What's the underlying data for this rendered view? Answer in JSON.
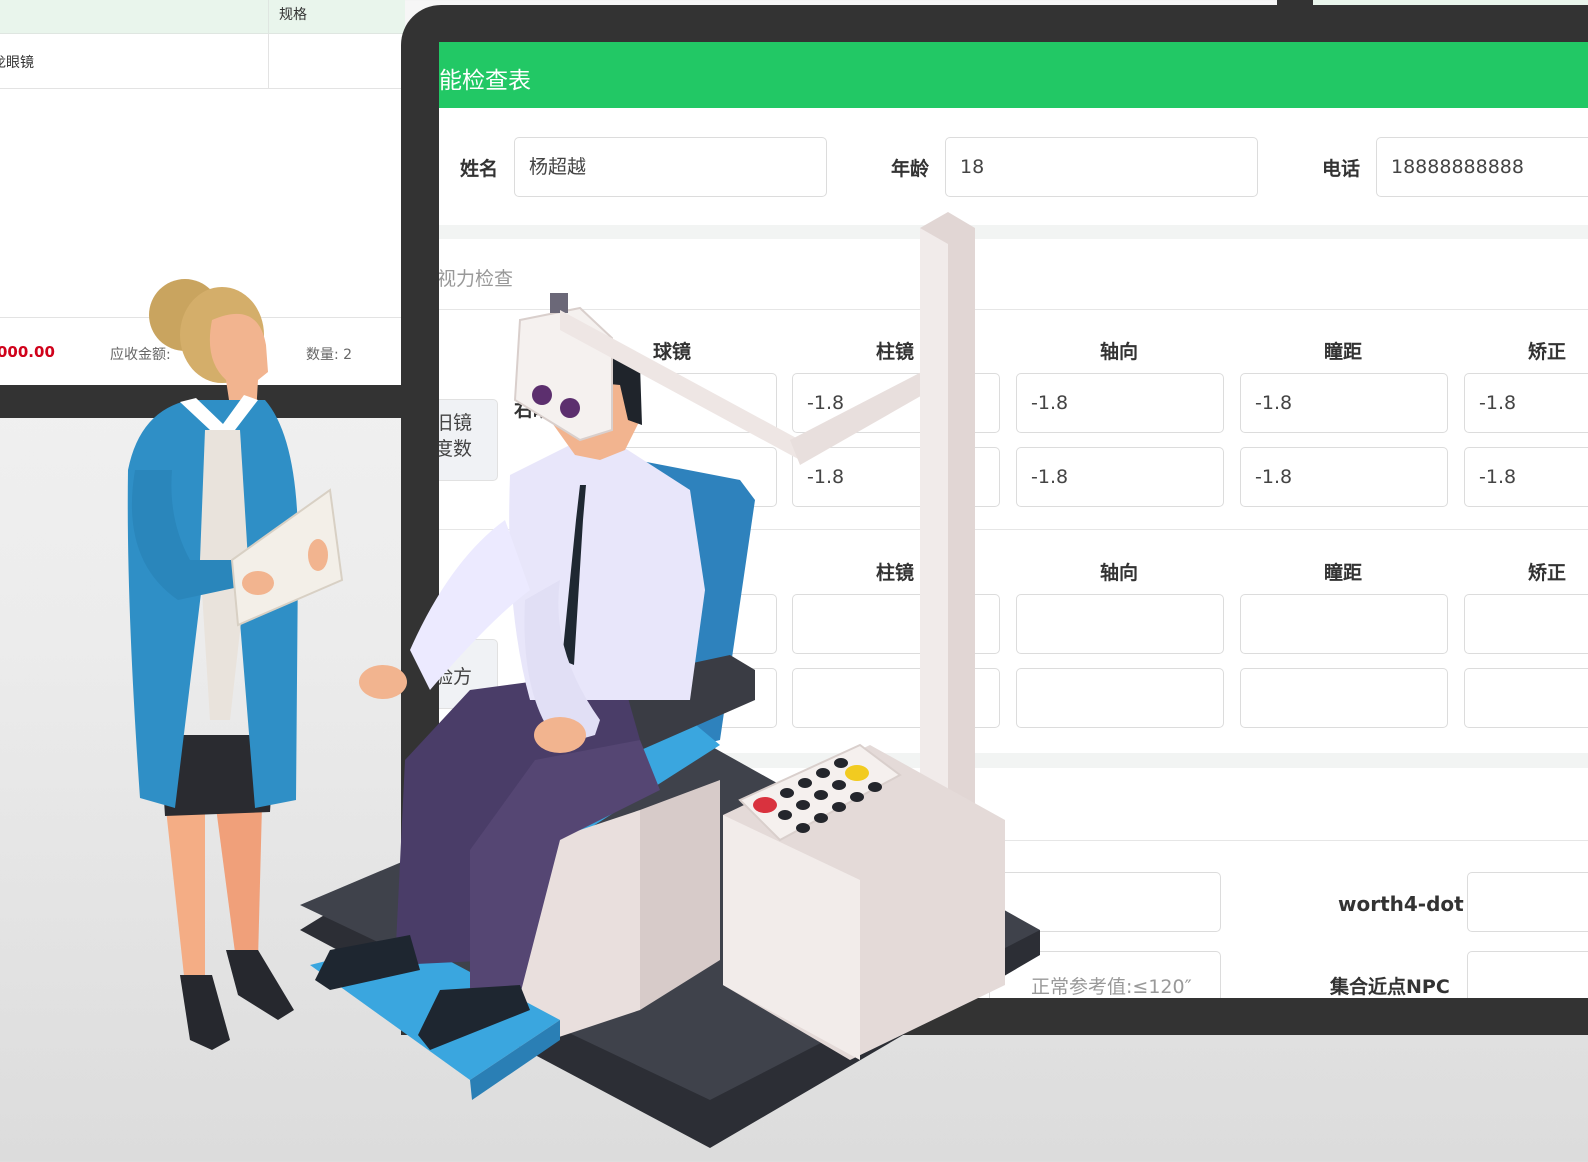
{
  "order": {
    "spec_header": "规格",
    "item_name": "龙眼镜",
    "amount": "000.00",
    "receivable_label": "应收金额:",
    "quantity_label": "数量: 2"
  },
  "form": {
    "title": "能检查表",
    "name_label": "姓名",
    "name_value": "杨超越",
    "age_label": "年龄",
    "age_value": "18",
    "phone_label": "电话",
    "phone_value": "18888888888",
    "section_title": "视力检查",
    "old_glasses_label_1": "旧镜",
    "old_glasses_label_2": "度数",
    "right_eye_label": "右眼",
    "rx_label": "验方",
    "cols_1": [
      "球镜",
      "柱镜",
      "轴向",
      "瞳距",
      "矫正"
    ],
    "cols_2": [
      "柱镜",
      "轴向",
      "瞳距",
      "矫正"
    ],
    "old_values": {
      "row1": [
        "-1.8",
        "-1.8",
        "-1.8",
        "-1.8"
      ],
      "row2": [
        "-1.8",
        "-1.8",
        "-1.8",
        "-1.8"
      ]
    },
    "worth_label": "worth4-dot",
    "npc_label": "集合近点NPC",
    "normal_ref": "正常参考值:≤120″"
  },
  "colors": {
    "brand_green": "#22c865",
    "amount_red": "#d0021b",
    "monitor": "#333333"
  }
}
